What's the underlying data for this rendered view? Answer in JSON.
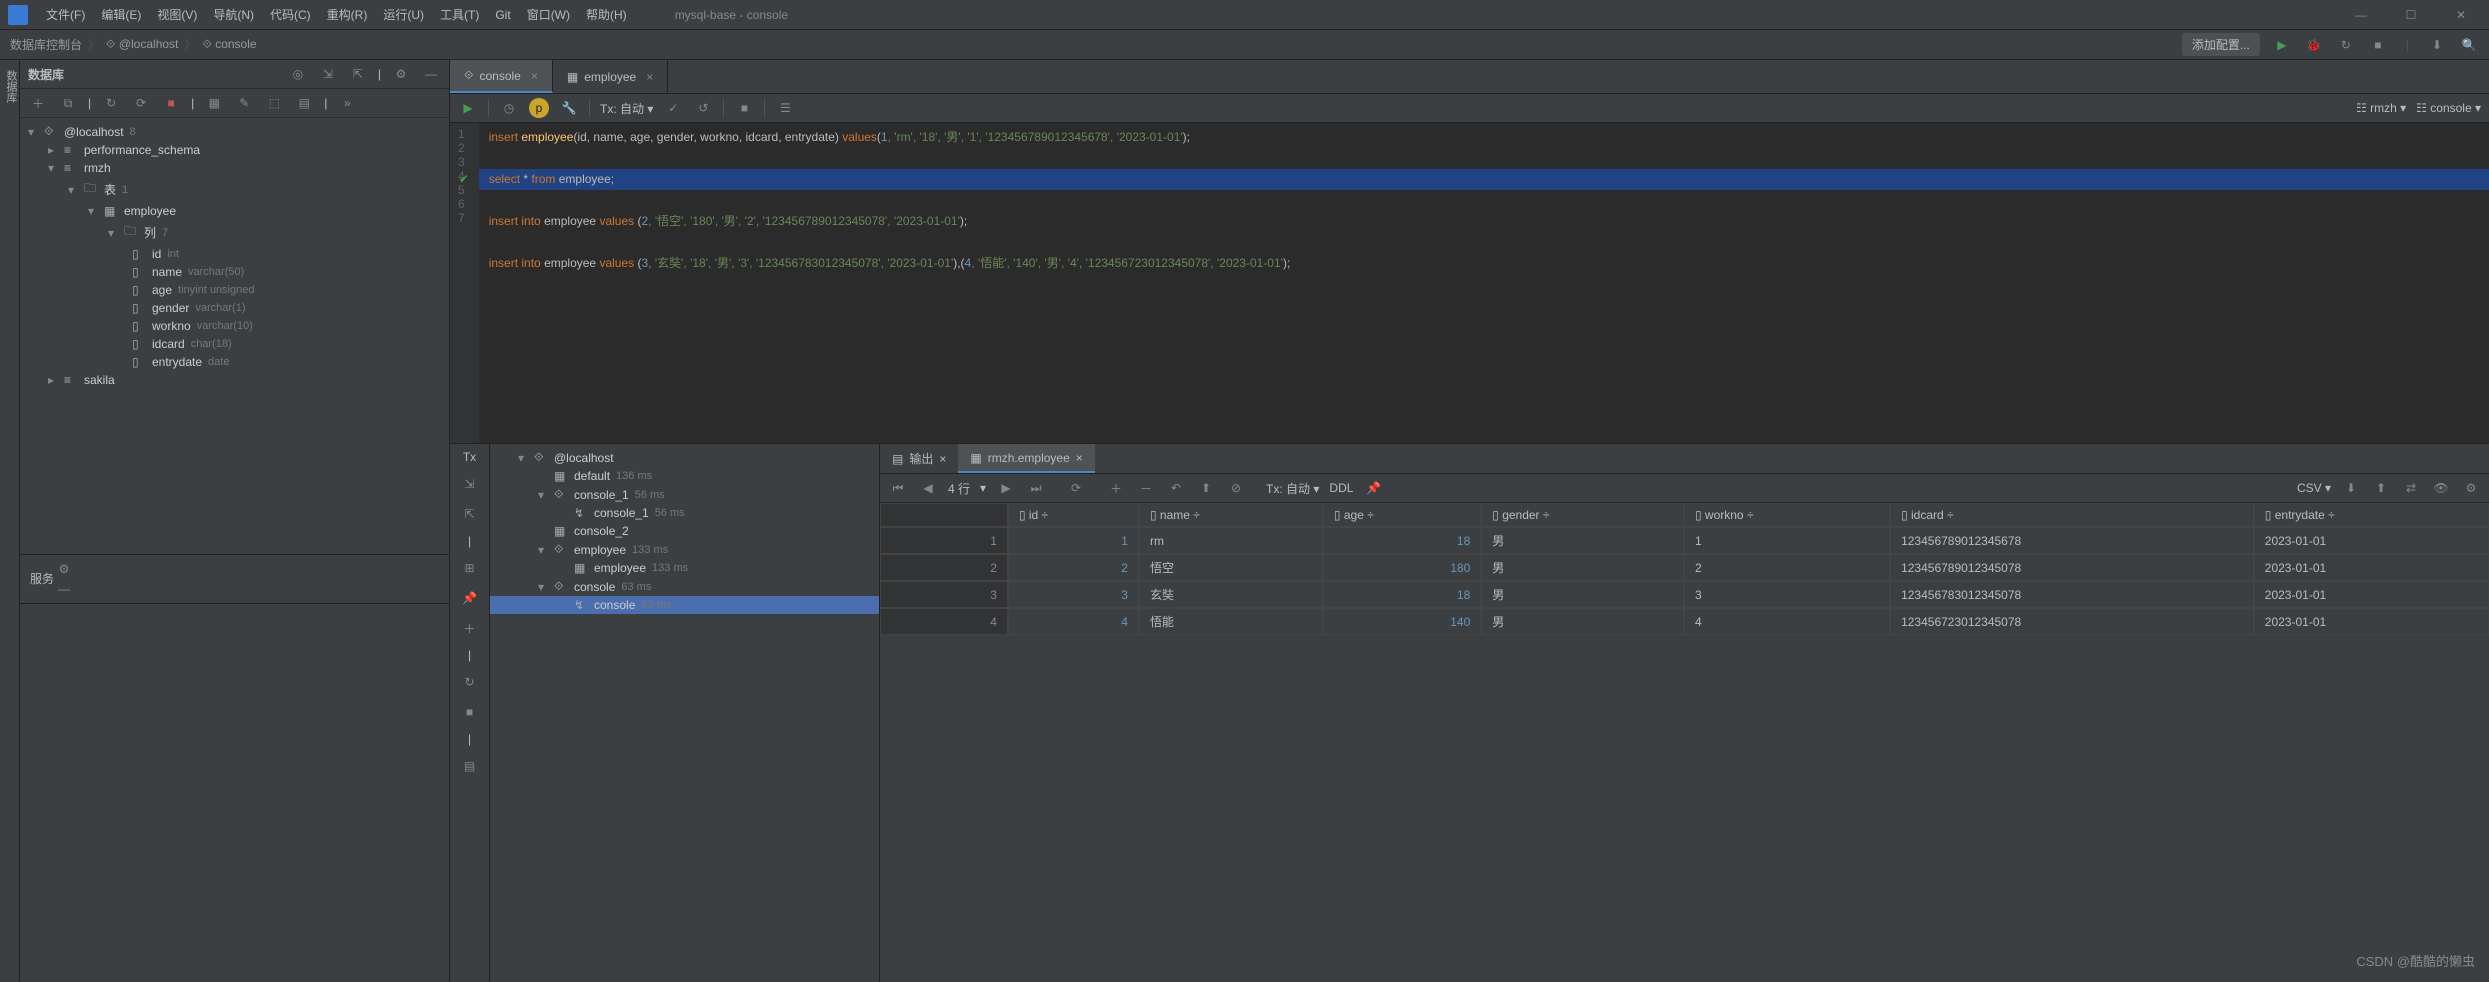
{
  "menu": {
    "items": [
      "文件(F)",
      "编辑(E)",
      "视图(V)",
      "导航(N)",
      "代码(C)",
      "重构(R)",
      "运行(U)",
      "工具(T)",
      "Git",
      "窗口(W)",
      "帮助(H)"
    ],
    "title": "mysql-base - console"
  },
  "breadcrumb": {
    "items": [
      "数据库控制台",
      "@localhost",
      "console"
    ],
    "config": "添加配置..."
  },
  "side": {
    "label": "数据库"
  },
  "dbpanel": {
    "title": "数据库"
  },
  "tree": {
    "host": "@localhost",
    "host_meta": "8",
    "schemas": [
      "performance_schema",
      "rmzh",
      "sakila"
    ],
    "tables_label": "表",
    "tables_meta": "1",
    "employee": "employee",
    "cols_label": "列",
    "cols_meta": "7",
    "cols": [
      {
        "n": "id",
        "t": "int"
      },
      {
        "n": "name",
        "t": "varchar(50)"
      },
      {
        "n": "age",
        "t": "tinyint unsigned"
      },
      {
        "n": "gender",
        "t": "varchar(1)"
      },
      {
        "n": "workno",
        "t": "varchar(10)"
      },
      {
        "n": "idcard",
        "t": "char(18)"
      },
      {
        "n": "entrydate",
        "t": "date"
      }
    ]
  },
  "editor": {
    "tabs": [
      {
        "l": "console",
        "active": true
      },
      {
        "l": "employee",
        "active": false
      }
    ],
    "tx": "Tx: 自动",
    "badge_db": "rmzh",
    "badge_session": "console",
    "gutter": [
      "1",
      "2",
      "3",
      "4",
      "5",
      "6",
      "7"
    ],
    "l1": {
      "a": "insert",
      "b": "employee",
      "c": "(id, name, age, gender, workno, idcard, entrydate)",
      "d": "values",
      "e": "(",
      "n": "1",
      "s1": ", 'rm', '18', '男', '1', '123456789012345678',",
      "s2": "'2023-01-01'",
      "f": ");"
    },
    "l3": {
      "a": "select",
      "b": "*",
      "c": "from",
      "d": "employee",
      "e": ";"
    },
    "l5": {
      "a": "insert",
      "b": "into",
      "c": "employee",
      "d": "values",
      "e": "(",
      "n": "2",
      "s": ", '悟空', '180', '男', '2', '123456789012345078', '2023-01-01'",
      "f": ");"
    },
    "l7": {
      "a": "insert",
      "b": "into",
      "c": "employee",
      "d": "values",
      "e": "(",
      "n": "3",
      "s": ", '玄奘', '18', '男', '3', '123456783012345078', '2023-01-01'",
      "f": "),(",
      "n2": "4",
      "s2": ", '悟能', '140', '男', '4', '123456723012345078', '2023-01-01'",
      "g": ");"
    }
  },
  "services": {
    "title": "服务",
    "tree": [
      {
        "l": "@localhost",
        "ind": 1,
        "arr": "▾",
        "ic": "⟐"
      },
      {
        "l": "default",
        "m": "136 ms",
        "ind": 2,
        "arr": "",
        "ic": "▦"
      },
      {
        "l": "console_1",
        "m": "56 ms",
        "ind": 2,
        "arr": "▾",
        "ic": "⟐"
      },
      {
        "l": "console_1",
        "m": "56 ms",
        "ind": 3,
        "arr": "",
        "ic": "↯"
      },
      {
        "l": "console_2",
        "m": "",
        "ind": 2,
        "arr": "",
        "ic": "▦"
      },
      {
        "l": "employee",
        "m": "133 ms",
        "ind": 2,
        "arr": "▾",
        "ic": "⟐"
      },
      {
        "l": "employee",
        "m": "133 ms",
        "ind": 3,
        "arr": "",
        "ic": "▦"
      },
      {
        "l": "console",
        "m": "63 ms",
        "ind": 2,
        "arr": "▾",
        "ic": "⟐"
      },
      {
        "l": "console",
        "m": "63 ms",
        "ind": 3,
        "arr": "",
        "ic": "↯",
        "sel": true
      }
    ],
    "tabs": [
      {
        "l": "输出"
      },
      {
        "l": "rmzh.employee",
        "active": true
      }
    ],
    "rows_label": "4 行",
    "tx": "Tx: 自动",
    "ddl": "DDL",
    "csv": "CSV",
    "cols": [
      "id",
      "name",
      "age",
      "gender",
      "workno",
      "idcard",
      "entrydate"
    ],
    "rows": [
      {
        "rn": "1",
        "id": "1",
        "name": "rm",
        "age": "18",
        "gender": "男",
        "workno": "1",
        "idcard": "123456789012345678",
        "entrydate": "2023-01-01"
      },
      {
        "rn": "2",
        "id": "2",
        "name": "悟空",
        "age": "180",
        "gender": "男",
        "workno": "2",
        "idcard": "123456789012345078",
        "entrydate": "2023-01-01"
      },
      {
        "rn": "3",
        "id": "3",
        "name": "玄奘",
        "age": "18",
        "gender": "男",
        "workno": "3",
        "idcard": "123456783012345078",
        "entrydate": "2023-01-01"
      },
      {
        "rn": "4",
        "id": "4",
        "name": "悟能",
        "age": "140",
        "gender": "男",
        "workno": "4",
        "idcard": "123456723012345078",
        "entrydate": "2023-01-01"
      }
    ]
  },
  "watermark": "CSDN @酷酷的懒虫"
}
